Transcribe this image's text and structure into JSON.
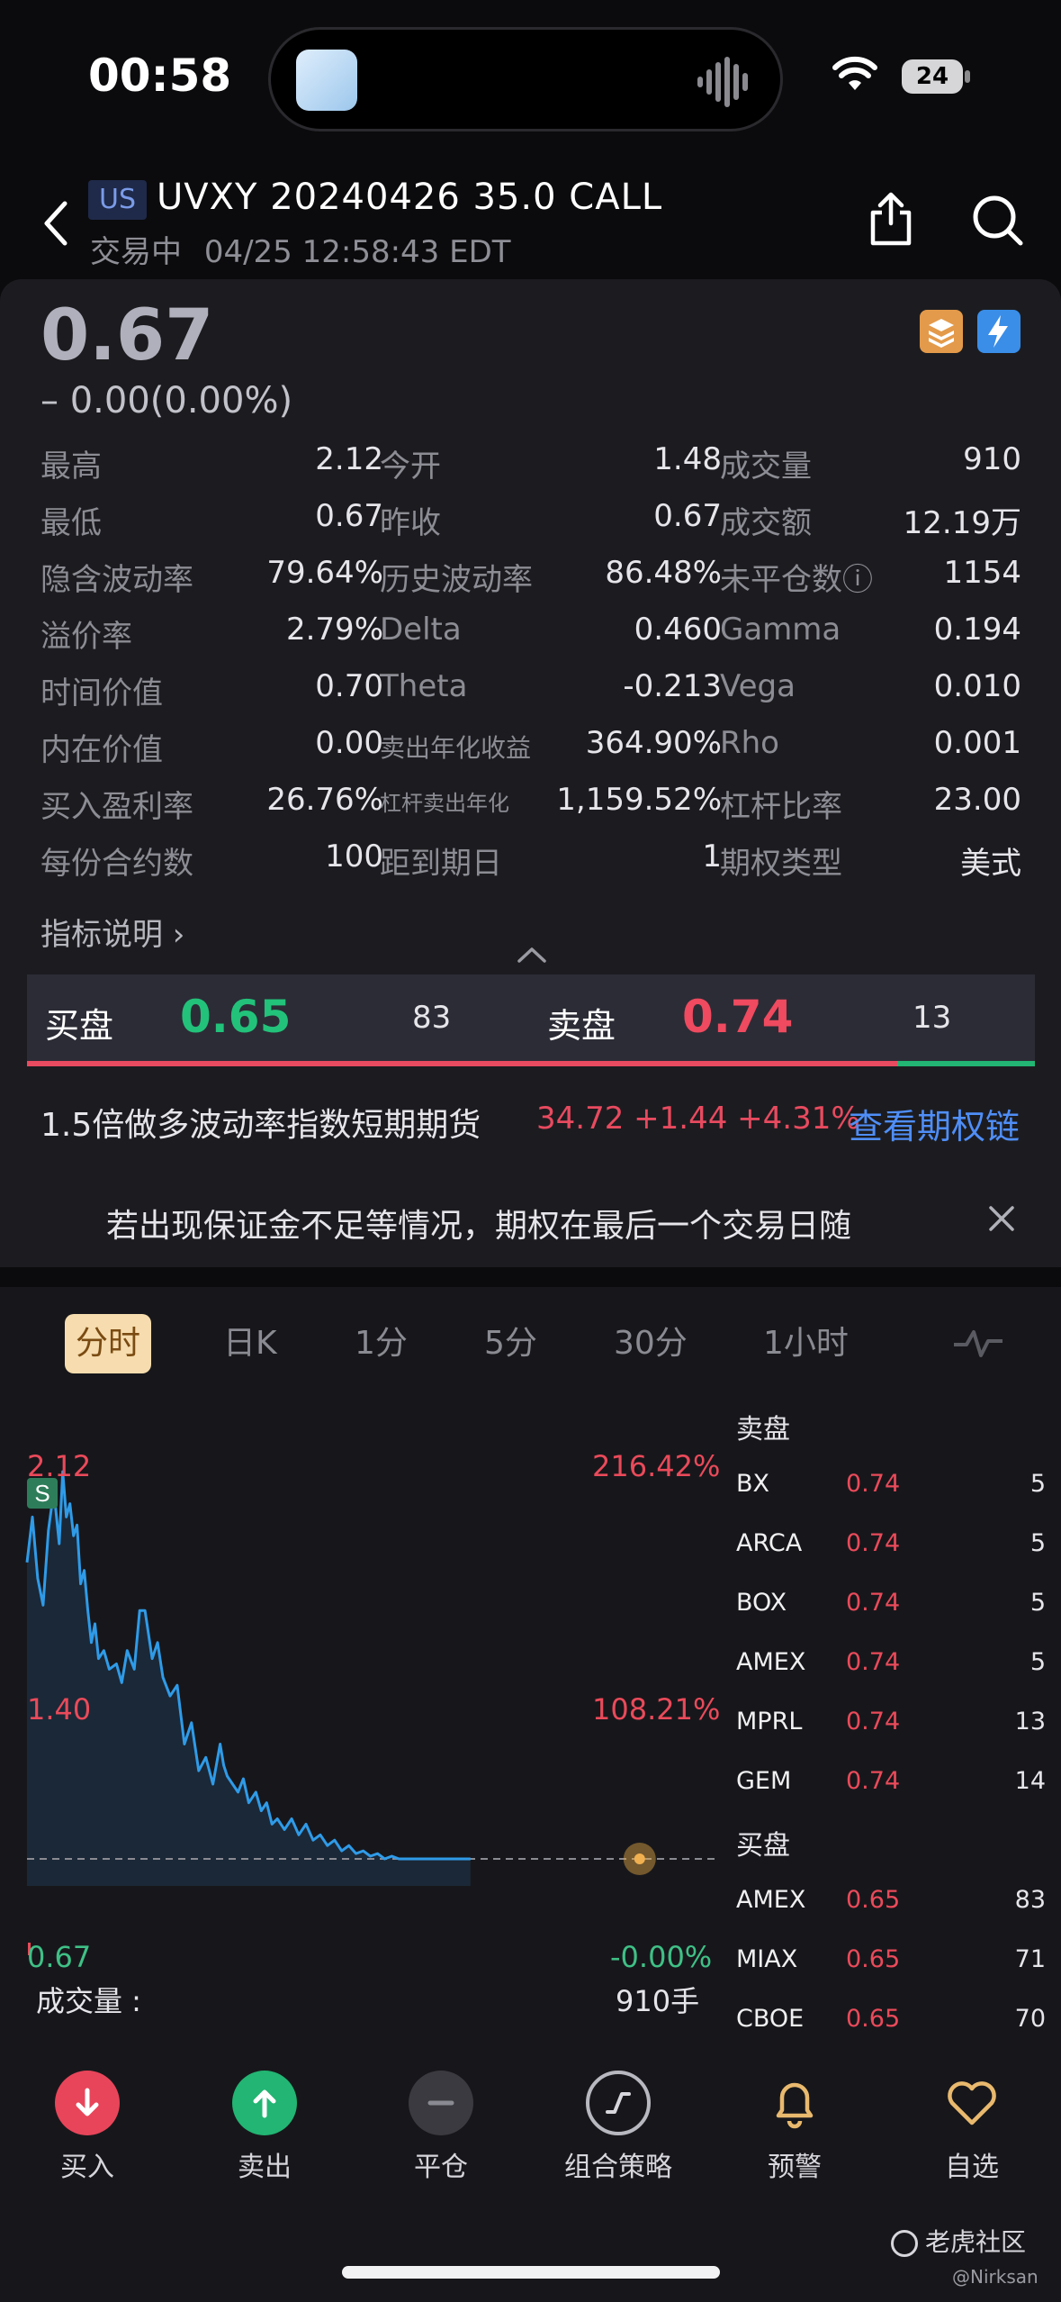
{
  "status_bar": {
    "time": "00:58",
    "battery": "24"
  },
  "header": {
    "market_badge": "US",
    "title": "UVXY 20240426 35.0 CALL",
    "status": "交易中",
    "timestamp": "04/25 12:58:43 EDT"
  },
  "quote": {
    "price": "0.67",
    "change": "– 0.00(0.00%)",
    "stats": [
      [
        {
          "label": "最高",
          "value": "2.12"
        },
        {
          "label": "今开",
          "value": "1.48"
        },
        {
          "label": "成交量",
          "value": "910"
        }
      ],
      [
        {
          "label": "最低",
          "value": "0.67"
        },
        {
          "label": "昨收",
          "value": "0.67"
        },
        {
          "label": "成交额",
          "value": "12.19万"
        }
      ],
      [
        {
          "label": "隐含波动率",
          "value": "79.64%"
        },
        {
          "label": "历史波动率",
          "value": "86.48%"
        },
        {
          "label": "未平仓数ⓘ",
          "value": "1154"
        }
      ],
      [
        {
          "label": "溢价率",
          "value": "2.79%"
        },
        {
          "label": "Delta",
          "value": "0.460"
        },
        {
          "label": "Gamma",
          "value": "0.194"
        }
      ],
      [
        {
          "label": "时间价值",
          "value": "0.70"
        },
        {
          "label": "Theta",
          "value": "-0.213"
        },
        {
          "label": "Vega",
          "value": "0.010"
        }
      ],
      [
        {
          "label": "内在价值",
          "value": "0.00"
        },
        {
          "label": "卖出年化收益",
          "value": "364.90%"
        },
        {
          "label": "Rho",
          "value": "0.001"
        }
      ],
      [
        {
          "label": "买入盈利率",
          "value": "26.76%"
        },
        {
          "label": "杠杆卖出年化",
          "value": "1,159.52%"
        },
        {
          "label": "杠杆比率",
          "value": "23.00"
        }
      ],
      [
        {
          "label": "每份合约数",
          "value": "100"
        },
        {
          "label": "距到期日",
          "value": "1"
        },
        {
          "label": "期权类型",
          "value": "美式"
        }
      ]
    ],
    "indicator_link": "指标说明 ›"
  },
  "bid_ask": {
    "bid_label": "买盘",
    "bid_price": "0.65",
    "bid_qty": "83",
    "ask_label": "卖盘",
    "ask_price": "0.74",
    "ask_qty": "13"
  },
  "underlying": {
    "name": "1.5倍做多波动率指数短期期货",
    "quote": "34.72 +1.44 +4.31%",
    "chain_link": "查看期权链"
  },
  "notice": {
    "text": "若出现保证金不足等情况，期权在最后一个交易日随"
  },
  "chart_tabs": [
    "分时",
    "日K",
    "1分",
    "5分",
    "30分",
    "1小时"
  ],
  "chart": {
    "high_label": "2.12",
    "high_pct": "216.42%",
    "mid_label": "1.40",
    "mid_pct": "108.21%",
    "low_label": "0.67",
    "low_pct": "-0.00%",
    "marker": "S",
    "volume_label": "成交量 :",
    "volume_value": "910手"
  },
  "chart_data": {
    "type": "line",
    "x": [
      0,
      3,
      6,
      9,
      12,
      15,
      18,
      20,
      22,
      24,
      26,
      28,
      30,
      32,
      34,
      36,
      38,
      40,
      43,
      46,
      50,
      53,
      56,
      60,
      63,
      66,
      70,
      73,
      76,
      80,
      84,
      88,
      92,
      96,
      100,
      104,
      108,
      110,
      112,
      115,
      118,
      121,
      124,
      128,
      131,
      134,
      137,
      140,
      144,
      148,
      152,
      156,
      160,
      164,
      168,
      172,
      176,
      180,
      184,
      188,
      192,
      196,
      200,
      204,
      208,
      212,
      216,
      220,
      224,
      228,
      232,
      236,
      240,
      244,
      248
    ],
    "values": [
      1.78,
      1.95,
      1.72,
      1.62,
      1.9,
      2.05,
      1.85,
      2.12,
      1.95,
      2.0,
      1.88,
      1.92,
      1.7,
      1.75,
      1.6,
      1.48,
      1.55,
      1.42,
      1.45,
      1.38,
      1.4,
      1.33,
      1.45,
      1.38,
      1.6,
      1.6,
      1.42,
      1.48,
      1.35,
      1.28,
      1.32,
      1.1,
      1.18,
      1.0,
      1.05,
      0.95,
      1.1,
      1.02,
      0.98,
      0.95,
      0.92,
      0.97,
      0.88,
      0.92,
      0.85,
      0.88,
      0.8,
      0.82,
      0.78,
      0.82,
      0.76,
      0.8,
      0.74,
      0.76,
      0.72,
      0.74,
      0.7,
      0.72,
      0.69,
      0.7,
      0.68,
      0.69,
      0.67,
      0.68,
      0.67,
      0.67,
      0.67,
      0.67,
      0.67,
      0.67,
      0.67,
      0.67,
      0.67,
      0.67,
      0.67
    ],
    "ylim": [
      0.67,
      2.12
    ],
    "xlim": [
      0,
      385
    ],
    "reference_value": 0.67
  },
  "order_book": {
    "ask_header": "卖盘",
    "asks": [
      {
        "exchange": "BX",
        "price": "0.74",
        "qty": "5"
      },
      {
        "exchange": "ARCA",
        "price": "0.74",
        "qty": "5"
      },
      {
        "exchange": "BOX",
        "price": "0.74",
        "qty": "5"
      },
      {
        "exchange": "AMEX",
        "price": "0.74",
        "qty": "5"
      },
      {
        "exchange": "MPRL",
        "price": "0.74",
        "qty": "13"
      },
      {
        "exchange": "GEM",
        "price": "0.74",
        "qty": "14"
      }
    ],
    "bid_header": "买盘",
    "bids": [
      {
        "exchange": "AMEX",
        "price": "0.65",
        "qty": "83"
      },
      {
        "exchange": "MIAX",
        "price": "0.65",
        "qty": "71"
      },
      {
        "exchange": "CBOE",
        "price": "0.65",
        "qty": "70"
      }
    ]
  },
  "toolbar": [
    {
      "label": "买入",
      "icon": "arrow-down-icon",
      "color": "#e8455a"
    },
    {
      "label": "卖出",
      "icon": "arrow-up-icon",
      "color": "#22b573"
    },
    {
      "label": "平仓",
      "icon": "minus-icon",
      "color": "#3a3a40"
    },
    {
      "label": "组合策略",
      "icon": "strategy-icon",
      "color": "#3a3a40"
    },
    {
      "label": "预警",
      "icon": "bell-icon",
      "color": "#e9b96e"
    },
    {
      "label": "自选",
      "icon": "heart-icon",
      "color": "#e9b96e"
    }
  ],
  "watermark": {
    "brand": "老虎社区",
    "handle": "@Nirksan"
  }
}
